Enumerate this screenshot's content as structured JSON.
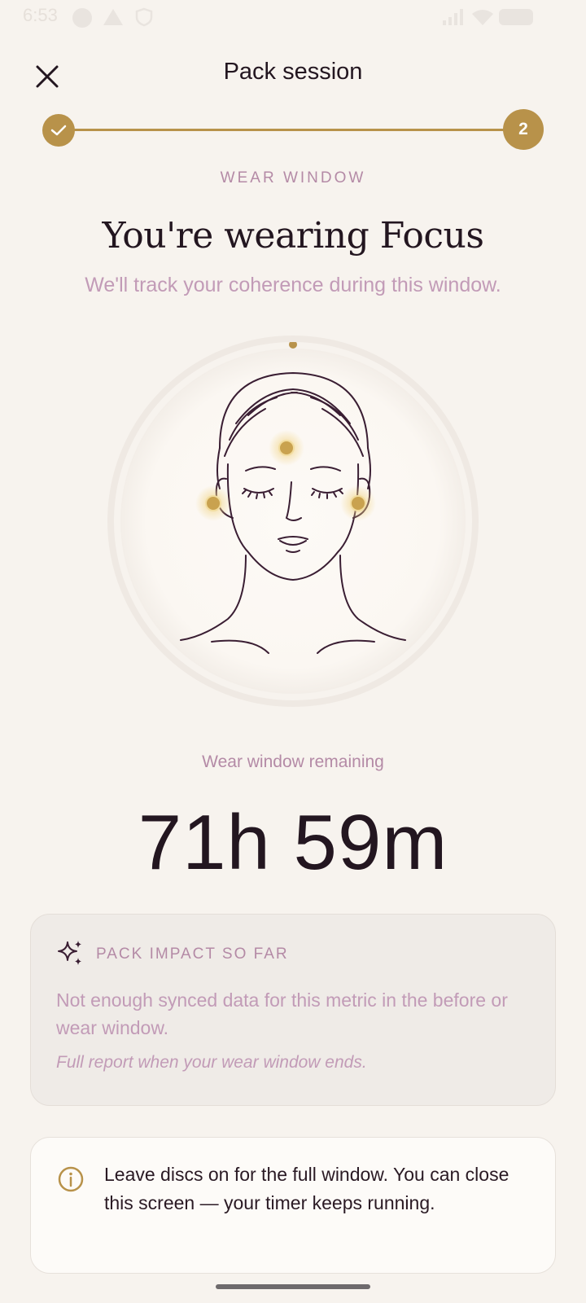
{
  "status_bar": {
    "time": "6:53",
    "icons": [
      "notification-dot-icon",
      "warning-icon",
      "shield-icon",
      "signal-icon",
      "wifi-icon",
      "battery-icon"
    ]
  },
  "header": {
    "title": "Pack session",
    "close_icon": "close-icon"
  },
  "stepper": {
    "current_step": "2",
    "completed_icon": "check-icon"
  },
  "hero": {
    "eyebrow": "WEAR WINDOW",
    "headline": "You're wearing Focus",
    "subhead": "We'll track your coherence during this window."
  },
  "illustration": {
    "name": "face-illustration",
    "points": [
      "forehead-point",
      "left-ear-point",
      "right-ear-point"
    ]
  },
  "timer": {
    "label": "Wear window remaining",
    "value": "71h 59m"
  },
  "impact_card": {
    "icon": "sparkle-icon",
    "label": "PACK IMPACT SO FAR",
    "body": "Not enough synced data for this metric in the before or wear window.",
    "note": "Full report when your wear window ends."
  },
  "info_card": {
    "icon": "info-icon",
    "text": "Leave discs on for the full window. You can close this screen — your timer keeps running."
  },
  "colors": {
    "accent": "#b8924a",
    "background": "#f7f3ee",
    "muted_text": "#c29bb7",
    "primary_text": "#231620"
  }
}
